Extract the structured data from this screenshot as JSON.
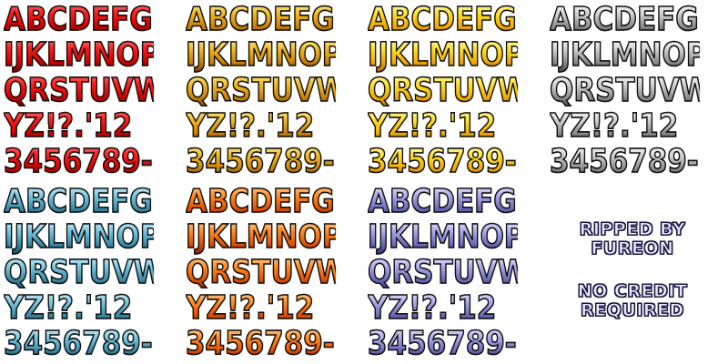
{
  "sprite_sheet": {
    "glyph_rows": [
      "ABCDEFGH",
      "IJKLMNOP",
      "QRSTUVWX",
      "YZ!?.'12",
      "3456789-"
    ],
    "variants": [
      {
        "id": "red",
        "color": "#e00000"
      },
      {
        "id": "amber",
        "color": "#d89000"
      },
      {
        "id": "yellow",
        "color": "#ffd000"
      },
      {
        "id": "silver",
        "color": "#9a9a9a"
      },
      {
        "id": "teal",
        "color": "#4a9ab8"
      },
      {
        "id": "orange",
        "color": "#f06010"
      },
      {
        "id": "purple",
        "color": "#7a7ac8"
      }
    ]
  },
  "credits": {
    "line1": "RIPPED BY",
    "line2": "FUREON",
    "line3": "NO CREDIT",
    "line4": "REQUIRED"
  }
}
